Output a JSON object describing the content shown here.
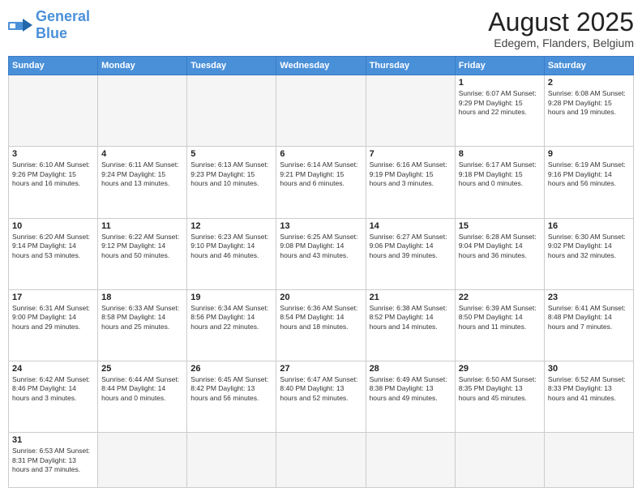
{
  "header": {
    "logo_general": "General",
    "logo_blue": "Blue",
    "month_year": "August 2025",
    "location": "Edegem, Flanders, Belgium"
  },
  "weekdays": [
    "Sunday",
    "Monday",
    "Tuesday",
    "Wednesday",
    "Thursday",
    "Friday",
    "Saturday"
  ],
  "weeks": [
    [
      {
        "day": "",
        "info": ""
      },
      {
        "day": "",
        "info": ""
      },
      {
        "day": "",
        "info": ""
      },
      {
        "day": "",
        "info": ""
      },
      {
        "day": "",
        "info": ""
      },
      {
        "day": "1",
        "info": "Sunrise: 6:07 AM\nSunset: 9:29 PM\nDaylight: 15 hours and 22 minutes."
      },
      {
        "day": "2",
        "info": "Sunrise: 6:08 AM\nSunset: 9:28 PM\nDaylight: 15 hours and 19 minutes."
      }
    ],
    [
      {
        "day": "3",
        "info": "Sunrise: 6:10 AM\nSunset: 9:26 PM\nDaylight: 15 hours and 16 minutes."
      },
      {
        "day": "4",
        "info": "Sunrise: 6:11 AM\nSunset: 9:24 PM\nDaylight: 15 hours and 13 minutes."
      },
      {
        "day": "5",
        "info": "Sunrise: 6:13 AM\nSunset: 9:23 PM\nDaylight: 15 hours and 10 minutes."
      },
      {
        "day": "6",
        "info": "Sunrise: 6:14 AM\nSunset: 9:21 PM\nDaylight: 15 hours and 6 minutes."
      },
      {
        "day": "7",
        "info": "Sunrise: 6:16 AM\nSunset: 9:19 PM\nDaylight: 15 hours and 3 minutes."
      },
      {
        "day": "8",
        "info": "Sunrise: 6:17 AM\nSunset: 9:18 PM\nDaylight: 15 hours and 0 minutes."
      },
      {
        "day": "9",
        "info": "Sunrise: 6:19 AM\nSunset: 9:16 PM\nDaylight: 14 hours and 56 minutes."
      }
    ],
    [
      {
        "day": "10",
        "info": "Sunrise: 6:20 AM\nSunset: 9:14 PM\nDaylight: 14 hours and 53 minutes."
      },
      {
        "day": "11",
        "info": "Sunrise: 6:22 AM\nSunset: 9:12 PM\nDaylight: 14 hours and 50 minutes."
      },
      {
        "day": "12",
        "info": "Sunrise: 6:23 AM\nSunset: 9:10 PM\nDaylight: 14 hours and 46 minutes."
      },
      {
        "day": "13",
        "info": "Sunrise: 6:25 AM\nSunset: 9:08 PM\nDaylight: 14 hours and 43 minutes."
      },
      {
        "day": "14",
        "info": "Sunrise: 6:27 AM\nSunset: 9:06 PM\nDaylight: 14 hours and 39 minutes."
      },
      {
        "day": "15",
        "info": "Sunrise: 6:28 AM\nSunset: 9:04 PM\nDaylight: 14 hours and 36 minutes."
      },
      {
        "day": "16",
        "info": "Sunrise: 6:30 AM\nSunset: 9:02 PM\nDaylight: 14 hours and 32 minutes."
      }
    ],
    [
      {
        "day": "17",
        "info": "Sunrise: 6:31 AM\nSunset: 9:00 PM\nDaylight: 14 hours and 29 minutes."
      },
      {
        "day": "18",
        "info": "Sunrise: 6:33 AM\nSunset: 8:58 PM\nDaylight: 14 hours and 25 minutes."
      },
      {
        "day": "19",
        "info": "Sunrise: 6:34 AM\nSunset: 8:56 PM\nDaylight: 14 hours and 22 minutes."
      },
      {
        "day": "20",
        "info": "Sunrise: 6:36 AM\nSunset: 8:54 PM\nDaylight: 14 hours and 18 minutes."
      },
      {
        "day": "21",
        "info": "Sunrise: 6:38 AM\nSunset: 8:52 PM\nDaylight: 14 hours and 14 minutes."
      },
      {
        "day": "22",
        "info": "Sunrise: 6:39 AM\nSunset: 8:50 PM\nDaylight: 14 hours and 11 minutes."
      },
      {
        "day": "23",
        "info": "Sunrise: 6:41 AM\nSunset: 8:48 PM\nDaylight: 14 hours and 7 minutes."
      }
    ],
    [
      {
        "day": "24",
        "info": "Sunrise: 6:42 AM\nSunset: 8:46 PM\nDaylight: 14 hours and 3 minutes."
      },
      {
        "day": "25",
        "info": "Sunrise: 6:44 AM\nSunset: 8:44 PM\nDaylight: 14 hours and 0 minutes."
      },
      {
        "day": "26",
        "info": "Sunrise: 6:45 AM\nSunset: 8:42 PM\nDaylight: 13 hours and 56 minutes."
      },
      {
        "day": "27",
        "info": "Sunrise: 6:47 AM\nSunset: 8:40 PM\nDaylight: 13 hours and 52 minutes."
      },
      {
        "day": "28",
        "info": "Sunrise: 6:49 AM\nSunset: 8:38 PM\nDaylight: 13 hours and 49 minutes."
      },
      {
        "day": "29",
        "info": "Sunrise: 6:50 AM\nSunset: 8:35 PM\nDaylight: 13 hours and 45 minutes."
      },
      {
        "day": "30",
        "info": "Sunrise: 6:52 AM\nSunset: 8:33 PM\nDaylight: 13 hours and 41 minutes."
      }
    ],
    [
      {
        "day": "31",
        "info": "Sunrise: 6:53 AM\nSunset: 8:31 PM\nDaylight: 13 hours and 37 minutes."
      },
      {
        "day": "",
        "info": ""
      },
      {
        "day": "",
        "info": ""
      },
      {
        "day": "",
        "info": ""
      },
      {
        "day": "",
        "info": ""
      },
      {
        "day": "",
        "info": ""
      },
      {
        "day": "",
        "info": ""
      }
    ]
  ]
}
